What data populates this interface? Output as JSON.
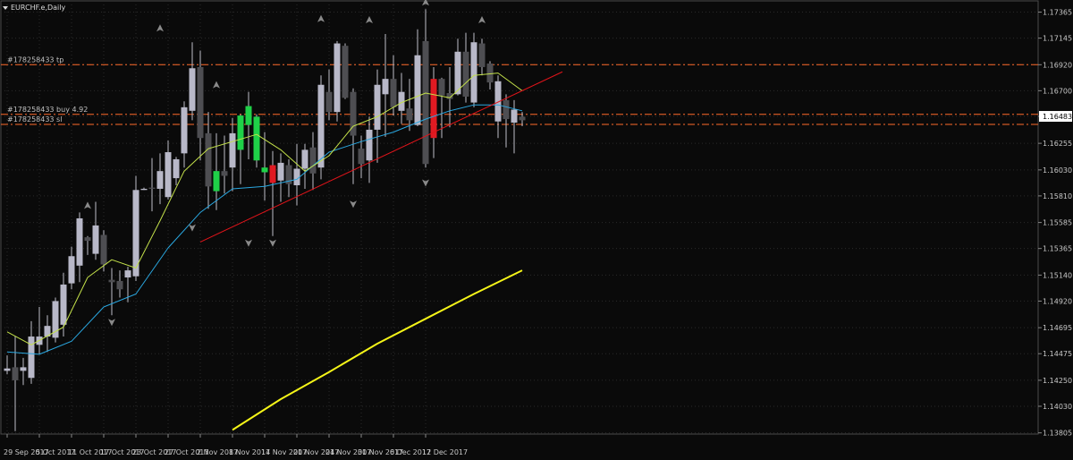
{
  "chart_title": "EURCHF.e,Daily",
  "title_icon": "triangle-down-icon",
  "colors": {
    "background": "#0a0a0a",
    "grid": "#2a2a2a",
    "axis_text": "#c8c8c8",
    "bull_candle": "#b8b8c8",
    "bear_candle": "#4e4e52",
    "highlight_bull": "#1fd148",
    "highlight_bear": "#e01a22",
    "ma_fast": "#c3e04a",
    "ma_mid": "#2aa7e0",
    "ma_slow": "#f5f518",
    "trendline": "#e0141a",
    "level_line": "#ff6a2a",
    "current_price_box": "#ffffff",
    "fractal_arrow": "#8a8a8a"
  },
  "order_lines": [
    {
      "label": "#178258433 tp",
      "price": 1.1692
    },
    {
      "label": "#178258433 buy 4.92",
      "price": 1.165
    },
    {
      "label": "#178258433 sl",
      "price": 1.16415
    }
  ],
  "current_price": "1.16483",
  "chart_data": {
    "type": "candlestick",
    "title": "EURCHF.e,Daily",
    "symbol": "EURCHF.e",
    "timeframe": "Daily",
    "y_ticks": [
      "1.17365",
      "1.17145",
      "1.16920",
      "1.16700",
      "1.16483",
      "1.16255",
      "1.16030",
      "1.15810",
      "1.15585",
      "1.15365",
      "1.15140",
      "1.14920",
      "1.14695",
      "1.14475",
      "1.14250",
      "1.14030",
      "1.13805"
    ],
    "ylim": [
      1.13795,
      1.1746
    ],
    "x_tick_labels": [
      {
        "label": "29 Sep 2017",
        "index": 0
      },
      {
        "label": "5 Oct 2017",
        "index": 4
      },
      {
        "label": "11 Oct 2017",
        "index": 8
      },
      {
        "label": "17 Oct 2017",
        "index": 12
      },
      {
        "label": "23 Oct 2017",
        "index": 16
      },
      {
        "label": "27 Oct 2017",
        "index": 20
      },
      {
        "label": "2 Nov 2017",
        "index": 24
      },
      {
        "label": "8 Nov 2017",
        "index": 28
      },
      {
        "label": "14 Nov 2017",
        "index": 32
      },
      {
        "label": "20 Nov 2017",
        "index": 36
      },
      {
        "label": "24 Nov 2017",
        "index": 40
      },
      {
        "label": "30 Nov 2017",
        "index": 44
      },
      {
        "label": "6 Dec 2017",
        "index": 48
      },
      {
        "label": "12 Dec 2017",
        "index": 52
      }
    ],
    "candles": [
      {
        "o": 1.1433,
        "h": 1.1446,
        "l": 1.143,
        "c": 1.1435
      },
      {
        "o": 1.1436,
        "h": 1.1462,
        "l": 1.1382,
        "c": 1.1425
      },
      {
        "o": 1.1433,
        "h": 1.1444,
        "l": 1.1421,
        "c": 1.1436
      },
      {
        "o": 1.1427,
        "h": 1.1475,
        "l": 1.1422,
        "c": 1.1462
      },
      {
        "o": 1.1455,
        "h": 1.1487,
        "l": 1.1447,
        "c": 1.1462
      },
      {
        "o": 1.1462,
        "h": 1.148,
        "l": 1.1449,
        "c": 1.1471
      },
      {
        "o": 1.1461,
        "h": 1.1495,
        "l": 1.1457,
        "c": 1.1492
      },
      {
        "o": 1.1472,
        "h": 1.1516,
        "l": 1.1462,
        "c": 1.1506
      },
      {
        "o": 1.1507,
        "h": 1.1538,
        "l": 1.1502,
        "c": 1.153
      },
      {
        "o": 1.1522,
        "h": 1.1567,
        "l": 1.1508,
        "c": 1.1562
      },
      {
        "o": 1.1546,
        "h": 1.1547,
        "l": 1.1531,
        "c": 1.1543
      },
      {
        "o": 1.1532,
        "h": 1.1576,
        "l": 1.1527,
        "c": 1.1556
      },
      {
        "o": 1.1548,
        "h": 1.1552,
        "l": 1.1517,
        "c": 1.1523
      },
      {
        "o": 1.151,
        "h": 1.152,
        "l": 1.148,
        "c": 1.1508
      },
      {
        "o": 1.1509,
        "h": 1.1518,
        "l": 1.1495,
        "c": 1.1502
      },
      {
        "o": 1.1512,
        "h": 1.1521,
        "l": 1.1491,
        "c": 1.1518
      },
      {
        "o": 1.1513,
        "h": 1.1598,
        "l": 1.1509,
        "c": 1.1586
      },
      {
        "o": 1.1586,
        "h": 1.1588,
        "l": 1.1586,
        "c": 1.1587
      },
      {
        "o": 1.1588,
        "h": 1.1613,
        "l": 1.1568,
        "c": 1.1587
      },
      {
        "o": 1.1587,
        "h": 1.1617,
        "l": 1.1574,
        "c": 1.1602
      },
      {
        "o": 1.158,
        "h": 1.1628,
        "l": 1.1578,
        "c": 1.1618
      },
      {
        "o": 1.1596,
        "h": 1.1614,
        "l": 1.159,
        "c": 1.1612
      },
      {
        "o": 1.1617,
        "h": 1.1661,
        "l": 1.1605,
        "c": 1.1656
      },
      {
        "o": 1.1653,
        "h": 1.1711,
        "l": 1.1645,
        "c": 1.1689
      },
      {
        "o": 1.169,
        "h": 1.1704,
        "l": 1.1611,
        "c": 1.163
      },
      {
        "o": 1.1634,
        "h": 1.1652,
        "l": 1.157,
        "c": 1.1589
      },
      {
        "o": 1.1585,
        "h": 1.1634,
        "l": 1.1569,
        "c": 1.1602
      },
      {
        "o": 1.1602,
        "h": 1.1632,
        "l": 1.1583,
        "c": 1.1598
      },
      {
        "o": 1.1605,
        "h": 1.1647,
        "l": 1.1585,
        "c": 1.1634
      },
      {
        "o": 1.162,
        "h": 1.165,
        "l": 1.1591,
        "c": 1.1649
      },
      {
        "o": 1.1657,
        "h": 1.1669,
        "l": 1.1612,
        "c": 1.1641
      },
      {
        "o": 1.1648,
        "h": 1.165,
        "l": 1.1605,
        "c": 1.1611
      },
      {
        "o": 1.1605,
        "h": 1.1635,
        "l": 1.1577,
        "c": 1.1601
      },
      {
        "o": 1.1607,
        "h": 1.1619,
        "l": 1.1547,
        "c": 1.1592
      },
      {
        "o": 1.1594,
        "h": 1.1617,
        "l": 1.1576,
        "c": 1.1609
      },
      {
        "o": 1.1607,
        "h": 1.1612,
        "l": 1.158,
        "c": 1.1591
      },
      {
        "o": 1.159,
        "h": 1.1625,
        "l": 1.1573,
        "c": 1.1604
      },
      {
        "o": 1.1604,
        "h": 1.1625,
        "l": 1.1587,
        "c": 1.162
      },
      {
        "o": 1.1622,
        "h": 1.1635,
        "l": 1.1586,
        "c": 1.16
      },
      {
        "o": 1.1605,
        "h": 1.1683,
        "l": 1.1595,
        "c": 1.1675
      },
      {
        "o": 1.1669,
        "h": 1.1688,
        "l": 1.1645,
        "c": 1.1652
      },
      {
        "o": 1.1652,
        "h": 1.1712,
        "l": 1.1644,
        "c": 1.171
      },
      {
        "o": 1.1708,
        "h": 1.171,
        "l": 1.1663,
        "c": 1.1664
      },
      {
        "o": 1.1669,
        "h": 1.1672,
        "l": 1.1591,
        "c": 1.1632
      },
      {
        "o": 1.1621,
        "h": 1.1632,
        "l": 1.1596,
        "c": 1.1608
      },
      {
        "o": 1.1611,
        "h": 1.1648,
        "l": 1.1592,
        "c": 1.1637
      },
      {
        "o": 1.1637,
        "h": 1.1688,
        "l": 1.1609,
        "c": 1.1675
      },
      {
        "o": 1.1667,
        "h": 1.1718,
        "l": 1.1631,
        "c": 1.168
      },
      {
        "o": 1.168,
        "h": 1.17,
        "l": 1.1649,
        "c": 1.1656
      },
      {
        "o": 1.1653,
        "h": 1.1685,
        "l": 1.1642,
        "c": 1.1669
      },
      {
        "o": 1.1655,
        "h": 1.168,
        "l": 1.1636,
        "c": 1.1645
      },
      {
        "o": 1.1641,
        "h": 1.1722,
        "l": 1.164,
        "c": 1.17
      },
      {
        "o": 1.1712,
        "h": 1.1739,
        "l": 1.1605,
        "c": 1.1608
      },
      {
        "o": 1.163,
        "h": 1.169,
        "l": 1.1613,
        "c": 1.168
      },
      {
        "o": 1.168,
        "h": 1.1681,
        "l": 1.163,
        "c": 1.1666
      },
      {
        "o": 1.1668,
        "h": 1.169,
        "l": 1.1639,
        "c": 1.1663
      },
      {
        "o": 1.1667,
        "h": 1.1714,
        "l": 1.1666,
        "c": 1.1703
      },
      {
        "o": 1.1703,
        "h": 1.1719,
        "l": 1.166,
        "c": 1.1665
      },
      {
        "o": 1.166,
        "h": 1.1719,
        "l": 1.1656,
        "c": 1.1711
      },
      {
        "o": 1.171,
        "h": 1.1714,
        "l": 1.1683,
        "c": 1.169
      },
      {
        "o": 1.1693,
        "h": 1.1695,
        "l": 1.1671,
        "c": 1.1677
      },
      {
        "o": 1.1644,
        "h": 1.1683,
        "l": 1.163,
        "c": 1.1678
      },
      {
        "o": 1.1662,
        "h": 1.1667,
        "l": 1.1622,
        "c": 1.1646
      },
      {
        "o": 1.1643,
        "h": 1.1662,
        "l": 1.1617,
        "c": 1.1654
      },
      {
        "o": 1.1648,
        "h": 1.1652,
        "l": 1.164,
        "c": 1.1645
      }
    ],
    "highlight_candles": {
      "bull": [
        26,
        29,
        30,
        31,
        32
      ],
      "bear": [
        33,
        53
      ]
    },
    "ma_fast": {
      "name": "",
      "points": [
        [
          0,
          1.1466
        ],
        [
          3,
          1.1455
        ],
        [
          7,
          1.147
        ],
        [
          10,
          1.1512
        ],
        [
          13,
          1.1527
        ],
        [
          16,
          1.152
        ],
        [
          19,
          1.156
        ],
        [
          22,
          1.1602
        ],
        [
          25,
          1.1621
        ],
        [
          28,
          1.1627
        ],
        [
          31,
          1.1633
        ],
        [
          34,
          1.162
        ],
        [
          37,
          1.1602
        ],
        [
          40,
          1.1615
        ],
        [
          43,
          1.164
        ],
        [
          46,
          1.1648
        ],
        [
          49,
          1.166
        ],
        [
          52,
          1.1668
        ],
        [
          55,
          1.1664
        ],
        [
          58,
          1.1683
        ],
        [
          61,
          1.1685
        ],
        [
          64,
          1.167
        ]
      ]
    },
    "ma_mid": {
      "name": "",
      "points": [
        [
          0,
          1.1449
        ],
        [
          4,
          1.1447
        ],
        [
          8,
          1.1458
        ],
        [
          12,
          1.1487
        ],
        [
          16,
          1.1498
        ],
        [
          20,
          1.1537
        ],
        [
          24,
          1.1567
        ],
        [
          28,
          1.1587
        ],
        [
          32,
          1.1589
        ],
        [
          36,
          1.1595
        ],
        [
          40,
          1.1618
        ],
        [
          44,
          1.1627
        ],
        [
          48,
          1.1635
        ],
        [
          52,
          1.1646
        ],
        [
          55,
          1.1653
        ],
        [
          58,
          1.1658
        ],
        [
          61,
          1.1658
        ],
        [
          64,
          1.1653
        ]
      ]
    },
    "ma_slow": {
      "name": "",
      "points": [
        [
          28,
          1.1383
        ],
        [
          34,
          1.1409
        ],
        [
          40,
          1.1432
        ],
        [
          46,
          1.1456
        ],
        [
          52,
          1.1477
        ],
        [
          58,
          1.1498
        ],
        [
          64,
          1.1518
        ]
      ]
    },
    "trendline": {
      "from": [
        24,
        1.1542
      ],
      "to": [
        69,
        1.1686
      ]
    },
    "fractal_up": [
      {
        "i": 10,
        "price": 1.1567
      },
      {
        "i": 19,
        "price": 1.1717
      },
      {
        "i": 26,
        "price": 1.1669
      },
      {
        "i": 39,
        "price": 1.1725
      },
      {
        "i": 45,
        "price": 1.1724
      },
      {
        "i": 52,
        "price": 1.1739
      },
      {
        "i": 59,
        "price": 1.1724
      }
    ],
    "fractal_down": [
      {
        "i": 13,
        "price": 1.148
      },
      {
        "i": 23,
        "price": 1.156
      },
      {
        "i": 30,
        "price": 1.1547
      },
      {
        "i": 33,
        "price": 1.1547
      },
      {
        "i": 43,
        "price": 1.158
      },
      {
        "i": 52,
        "price": 1.1598
      }
    ]
  }
}
